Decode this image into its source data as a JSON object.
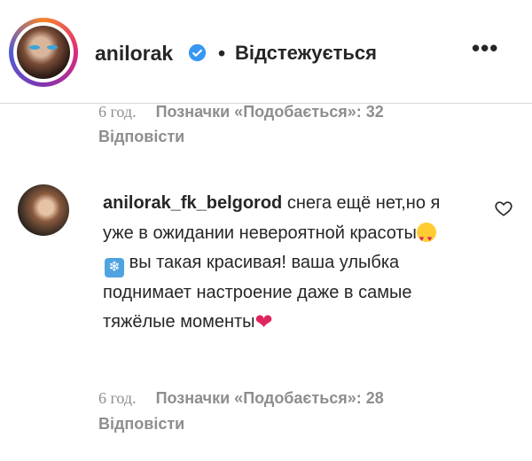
{
  "post": {
    "username": "anilorak",
    "separator": "•",
    "follow_status": "Відстежується",
    "more_label": "•••"
  },
  "comments": [
    {
      "time": "6 год.",
      "likes": "Позначки «Подобається»: 32",
      "reply": "Відповісти"
    },
    {
      "username": "anilorak_fk_belgorod",
      "text_1": "снега ещё нет,но я уже в ожидании невероятной красоты",
      "text_2": "вы такая красивая! ваша улыбка поднимает настроение даже в самые тяжёлые моменты",
      "snow_glyph": "❄",
      "heart_glyph": "❤",
      "time": "6 год.",
      "likes": "Позначки «Подобається»: 28",
      "reply": "Відповісти"
    }
  ],
  "icons": {
    "verified": "verified-badge-icon",
    "like": "heart-outline-icon",
    "accent": "#3897f0"
  }
}
